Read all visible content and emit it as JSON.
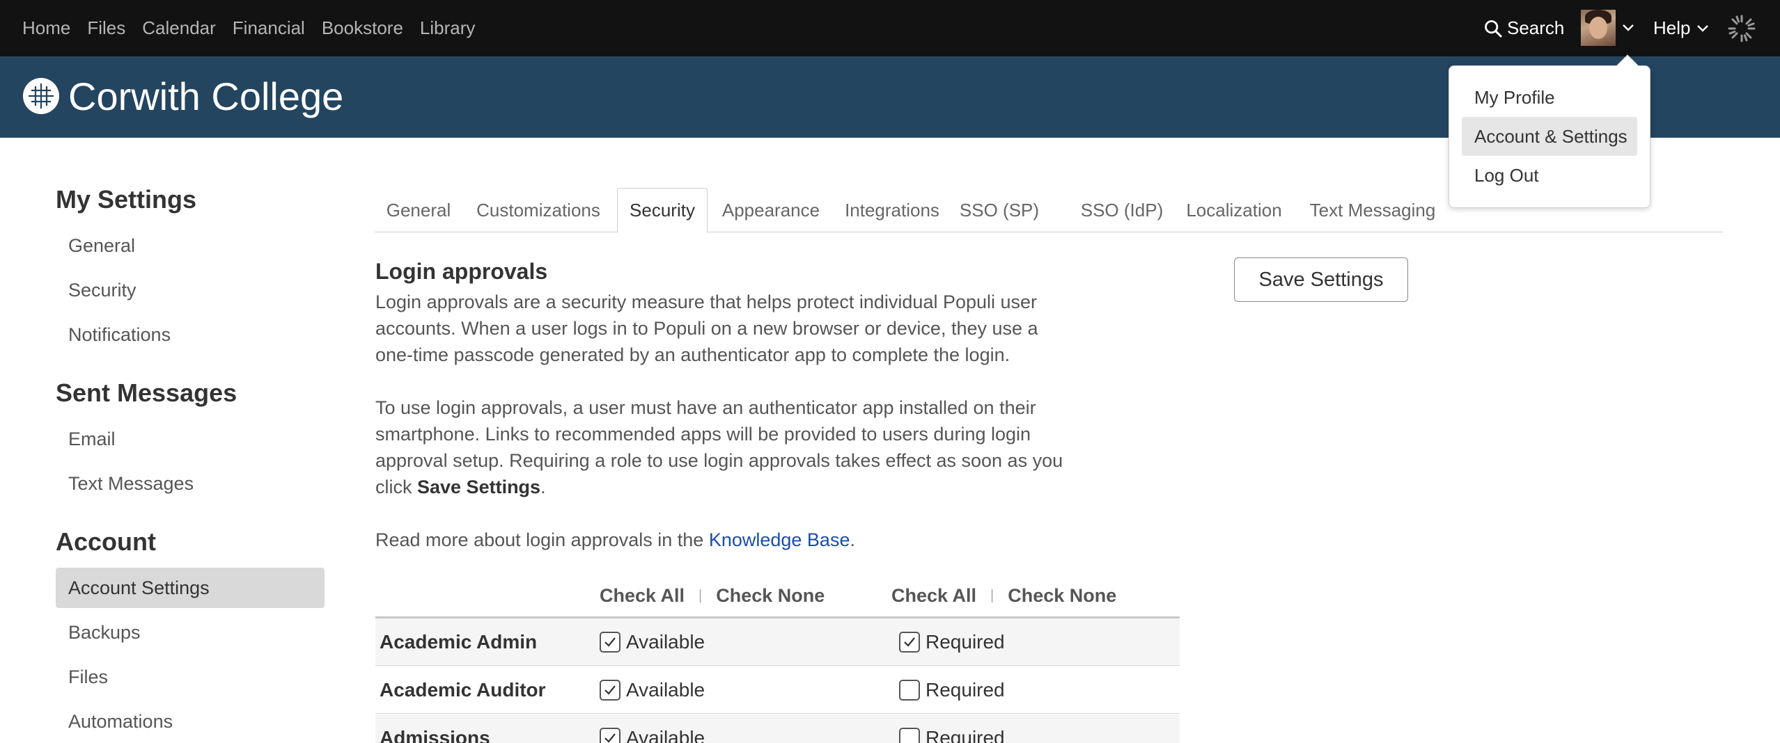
{
  "topnav": {
    "links": [
      "Home",
      "Files",
      "Calendar",
      "Financial",
      "Bookstore",
      "Library"
    ],
    "search_label": "Search",
    "help_label": "Help"
  },
  "header": {
    "college_name": "Corwith College"
  },
  "user_menu": {
    "items": [
      {
        "label": "My Profile"
      },
      {
        "label": "Account & Settings"
      },
      {
        "label": "Log Out"
      }
    ],
    "active_index": 1
  },
  "sidebar": {
    "sections": [
      {
        "heading": "My Settings",
        "items": [
          "General",
          "Security",
          "Notifications"
        ]
      },
      {
        "heading": "Sent Messages",
        "items": [
          "Email",
          "Text Messages"
        ]
      },
      {
        "heading": "Account",
        "items": [
          "Account Settings",
          "Backups",
          "Files",
          "Automations"
        ]
      }
    ],
    "active_item": "Account Settings"
  },
  "tabs": {
    "items": [
      "General",
      "Customizations",
      "Security",
      "Appearance",
      "Integrations",
      "SSO (SP)",
      "SSO (IdP)",
      "Localization",
      "Text Messaging"
    ],
    "active": "Security"
  },
  "content": {
    "title": "Login approvals",
    "para1": "Login approvals are a security measure that helps protect individual Populi user accounts. When a user logs in to Populi on a new browser or device, they use a one-time passcode generated by an authenticator app to complete the login.",
    "para2_prefix": "To use login approvals, a user must have an authenticator app installed on their smartphone. Links to recommended apps will be provided to users during login approval setup. Requiring a role to use login approvals takes effect as soon as you click ",
    "para2_bold": "Save Settings",
    "para2_suffix": ".",
    "para3_prefix": "Read more about login approvals in the ",
    "para3_link": "Knowledge Base",
    "para3_suffix": ".",
    "save_button": "Save Settings"
  },
  "table": {
    "check_all": "Check All",
    "check_none": "Check None",
    "available_label": "Available",
    "required_label": "Required",
    "rows": [
      {
        "name": "Academic Admin",
        "available": true,
        "required": true
      },
      {
        "name": "Academic Auditor",
        "available": true,
        "required": false
      },
      {
        "name": "Admissions",
        "available": true,
        "required": false
      }
    ]
  },
  "colors": {
    "topnav_bg": "#121212",
    "header_bg": "#234560",
    "link": "#1a4ea8"
  }
}
